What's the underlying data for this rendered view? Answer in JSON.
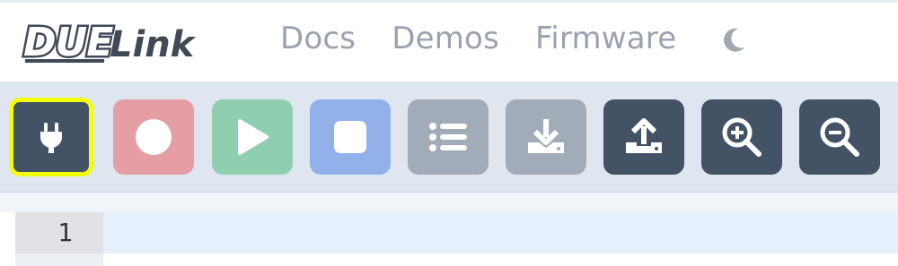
{
  "header": {
    "logo_text": "DUELink",
    "nav": [
      {
        "label": "Docs"
      },
      {
        "label": "Demos"
      },
      {
        "label": "Firmware"
      }
    ],
    "theme_toggle_icon": "moon-icon"
  },
  "toolbar": {
    "buttons": [
      {
        "name": "connect-button",
        "icon": "plug-icon",
        "color": "#445265",
        "highlighted": true
      },
      {
        "name": "record-button",
        "icon": "circle-icon",
        "color": "#e59ea3"
      },
      {
        "name": "play-button",
        "icon": "play-icon",
        "color": "#8fcfb0"
      },
      {
        "name": "stop-button",
        "icon": "square-stop-icon",
        "color": "#92b0ea"
      },
      {
        "name": "list-button",
        "icon": "list-icon",
        "color": "#a2abb8"
      },
      {
        "name": "download-button",
        "icon": "download-icon",
        "color": "#a2abb8"
      },
      {
        "name": "upload-button",
        "icon": "upload-icon",
        "color": "#445265"
      },
      {
        "name": "zoom-in-button",
        "icon": "zoom-in-icon",
        "color": "#445265"
      },
      {
        "name": "zoom-out-button",
        "icon": "zoom-out-icon",
        "color": "#445265"
      }
    ],
    "highlight_color": "#f3ff00"
  },
  "editor": {
    "lines": [
      {
        "number": "1",
        "text": ""
      }
    ]
  }
}
